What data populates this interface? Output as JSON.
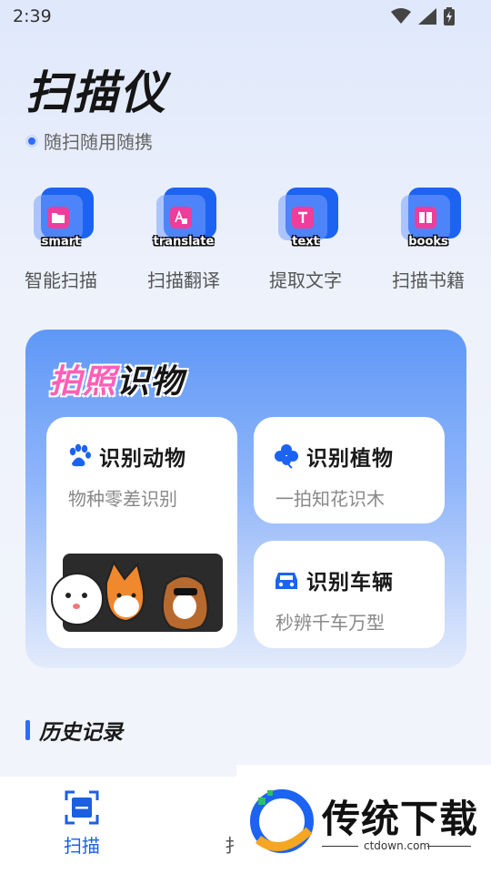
{
  "status": {
    "time": "2:39"
  },
  "header": {
    "title": "扫描仪",
    "subtitle": "随扫随用随携"
  },
  "tools": [
    {
      "tag": "smart",
      "label": "智能扫描",
      "icon": "folder-icon"
    },
    {
      "tag": "translate",
      "label": "扫描翻译",
      "icon": "translate-icon"
    },
    {
      "tag": "text",
      "label": "提取文字",
      "icon": "text-icon"
    },
    {
      "tag": "books",
      "label": "扫描书籍",
      "icon": "book-icon"
    }
  ],
  "photo": {
    "title_pink": "拍照",
    "title_dark": "识物",
    "cards": {
      "animal": {
        "title": "识别动物",
        "sub": "物种零差识别",
        "icon": "paw-icon"
      },
      "plant": {
        "title": "识别植物",
        "sub": "一拍知花识木",
        "icon": "clover-icon"
      },
      "vehicle": {
        "title": "识别车辆",
        "sub": "秒辨千车万型",
        "icon": "car-icon"
      }
    }
  },
  "history": {
    "title": "历史记录"
  },
  "nav": {
    "scan": "扫描",
    "second_partial": "扌"
  },
  "watermark": {
    "text": "传统下载",
    "url": "ctdown.com"
  },
  "colors": {
    "accent": "#1c63f2",
    "pink": "#ff5fb6",
    "badge": "#ee3d9a"
  }
}
